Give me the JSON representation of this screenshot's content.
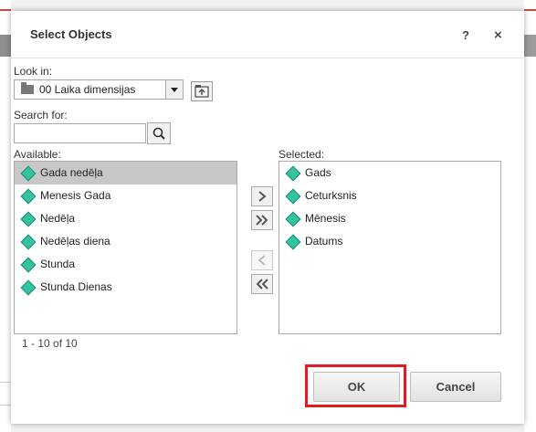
{
  "dialog": {
    "title": "Select Objects",
    "help_label": "?",
    "close_label": "×"
  },
  "look_in": {
    "label": "Look in:",
    "selected": "00 Laika dimensijas"
  },
  "search": {
    "label": "Search for:",
    "value": "",
    "placeholder": ""
  },
  "available": {
    "label": "Available:",
    "items": [
      "Gada nedēļa",
      "Menesis Gada",
      "Nedēļa",
      "Nedēļas diena",
      "Stunda",
      "Stunda Dienas"
    ],
    "selected_index": 0,
    "count_text": "1 - 10 of 10"
  },
  "selected_list": {
    "label": "Selected:",
    "items": [
      "Gads",
      "Ceturksnis",
      "Mēnesis",
      "Datums"
    ]
  },
  "buttons": {
    "ok": "OK",
    "cancel": "Cancel"
  },
  "colors": {
    "item_icon": "#35c2a1",
    "highlight_frame": "#e01b22",
    "selected_row": "#c8c8c8"
  }
}
